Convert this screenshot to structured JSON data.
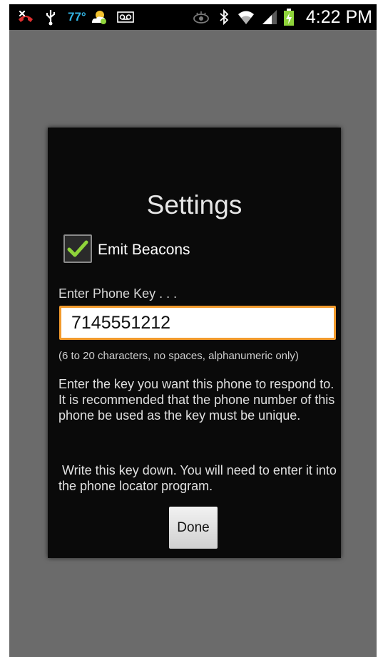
{
  "status_bar": {
    "temperature": "77°",
    "time": "4:22 PM",
    "icons": [
      "missed-call-icon",
      "usb-icon",
      "weather-icon",
      "voicemail-icon",
      "eye-icon",
      "bluetooth-icon",
      "wifi-icon",
      "signal-icon",
      "battery-charging-icon"
    ],
    "accent_color": "#33b5e5"
  },
  "dialog": {
    "title": "Settings",
    "emit_beacons": {
      "label": "Emit Beacons",
      "checked": true,
      "check_color": "#8fd43a"
    },
    "phone_key": {
      "label": "Enter Phone Key . . .",
      "value": "7145551212",
      "focus_color": "#f29b2d"
    },
    "hint": "(6 to 20 characters, no spaces, alphanumeric only)",
    "instructions": "Enter the key you want this phone to respond to. It is recommended that the phone number of this phone be used as the key must be unique.",
    "reminder": "Write this key down. You will need to enter it into the phone locator program.",
    "done_label": "Done"
  }
}
